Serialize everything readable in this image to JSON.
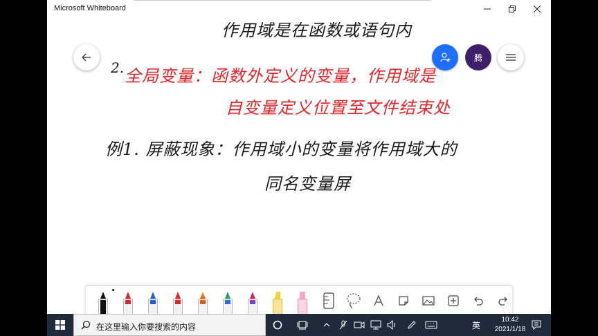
{
  "window": {
    "title": "Microsoft Whiteboard"
  },
  "header_buttons": {
    "avatar_initial": "腾"
  },
  "canvas": {
    "line0": "作用域是在函数或语句内",
    "line1_num": "2.",
    "line1_red": "全局变量：函数外定义的变量，作用域是",
    "line2_red": "自变量定义位置至文件结束处",
    "line3": "例1.  屏蔽现象：作用域小的变量将作用域大的",
    "line4": "同名变量屏"
  },
  "toolbar": {
    "pens": [
      {
        "name": "black",
        "color": "#111111"
      },
      {
        "name": "red",
        "color": "#d9262a"
      },
      {
        "name": "blue",
        "color": "#1f5fd6"
      },
      {
        "name": "red2",
        "color": "#e0262a"
      },
      {
        "name": "rainbow1",
        "color": "#e05a1a"
      },
      {
        "name": "rainbow2",
        "color": "#2b6fd6"
      },
      {
        "name": "rainbow3",
        "color": "#7a3fc2"
      },
      {
        "name": "highlighter-yellow",
        "color": "#f3d23b"
      },
      {
        "name": "highlighter-pink",
        "color": "#f6a6c9"
      }
    ],
    "icons": [
      "ruler-icon",
      "lasso-icon",
      "text-icon",
      "note-icon",
      "image-icon",
      "add-icon",
      "undo-icon",
      "redo-icon"
    ]
  },
  "taskbar": {
    "search_placeholder": "在这里输入你要搜索的内容",
    "ime": "英",
    "time": "10:42",
    "date": "2021/1/18"
  }
}
